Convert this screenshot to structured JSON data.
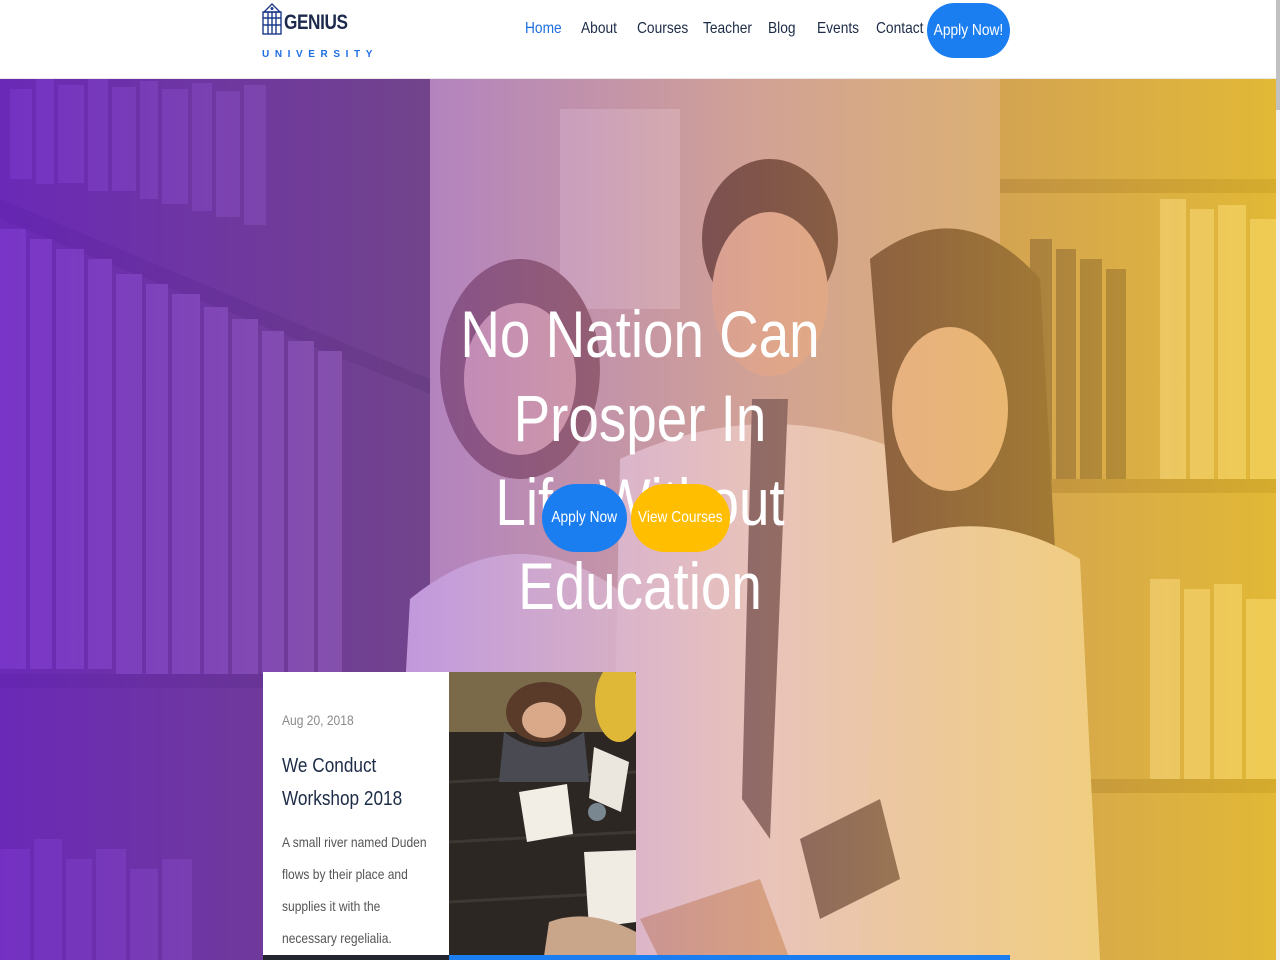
{
  "brand": {
    "name": "GENIUS",
    "subtitle": "UNIVERSITY",
    "icon": "university-building-icon"
  },
  "nav": {
    "items": [
      {
        "label": "Home",
        "active": true
      },
      {
        "label": "About",
        "active": false
      },
      {
        "label": "Courses",
        "active": false
      },
      {
        "label": "Teacher",
        "active": false
      },
      {
        "label": "Blog",
        "active": false
      },
      {
        "label": "Events",
        "active": false
      },
      {
        "label": "Contact",
        "active": false
      }
    ],
    "apply_label": "Apply Now!"
  },
  "hero": {
    "title_line1": "No Nation Can Prosper In",
    "title_line2": "Life Without Education",
    "apply_label": "Apply Now",
    "courses_label": "View Courses",
    "gradient_left": "#7d28e6",
    "gradient_right": "#f2c428"
  },
  "event": {
    "date": "Aug 20, 2018",
    "title": "We Conduct Workshop 2018",
    "description": "A small river named Duden flows by their place and supplies it with the necessary regelialia."
  },
  "colors": {
    "primary_blue": "#1a7ef0",
    "accent_yellow": "#ffbe00",
    "heading_dark": "#1c2b47"
  }
}
